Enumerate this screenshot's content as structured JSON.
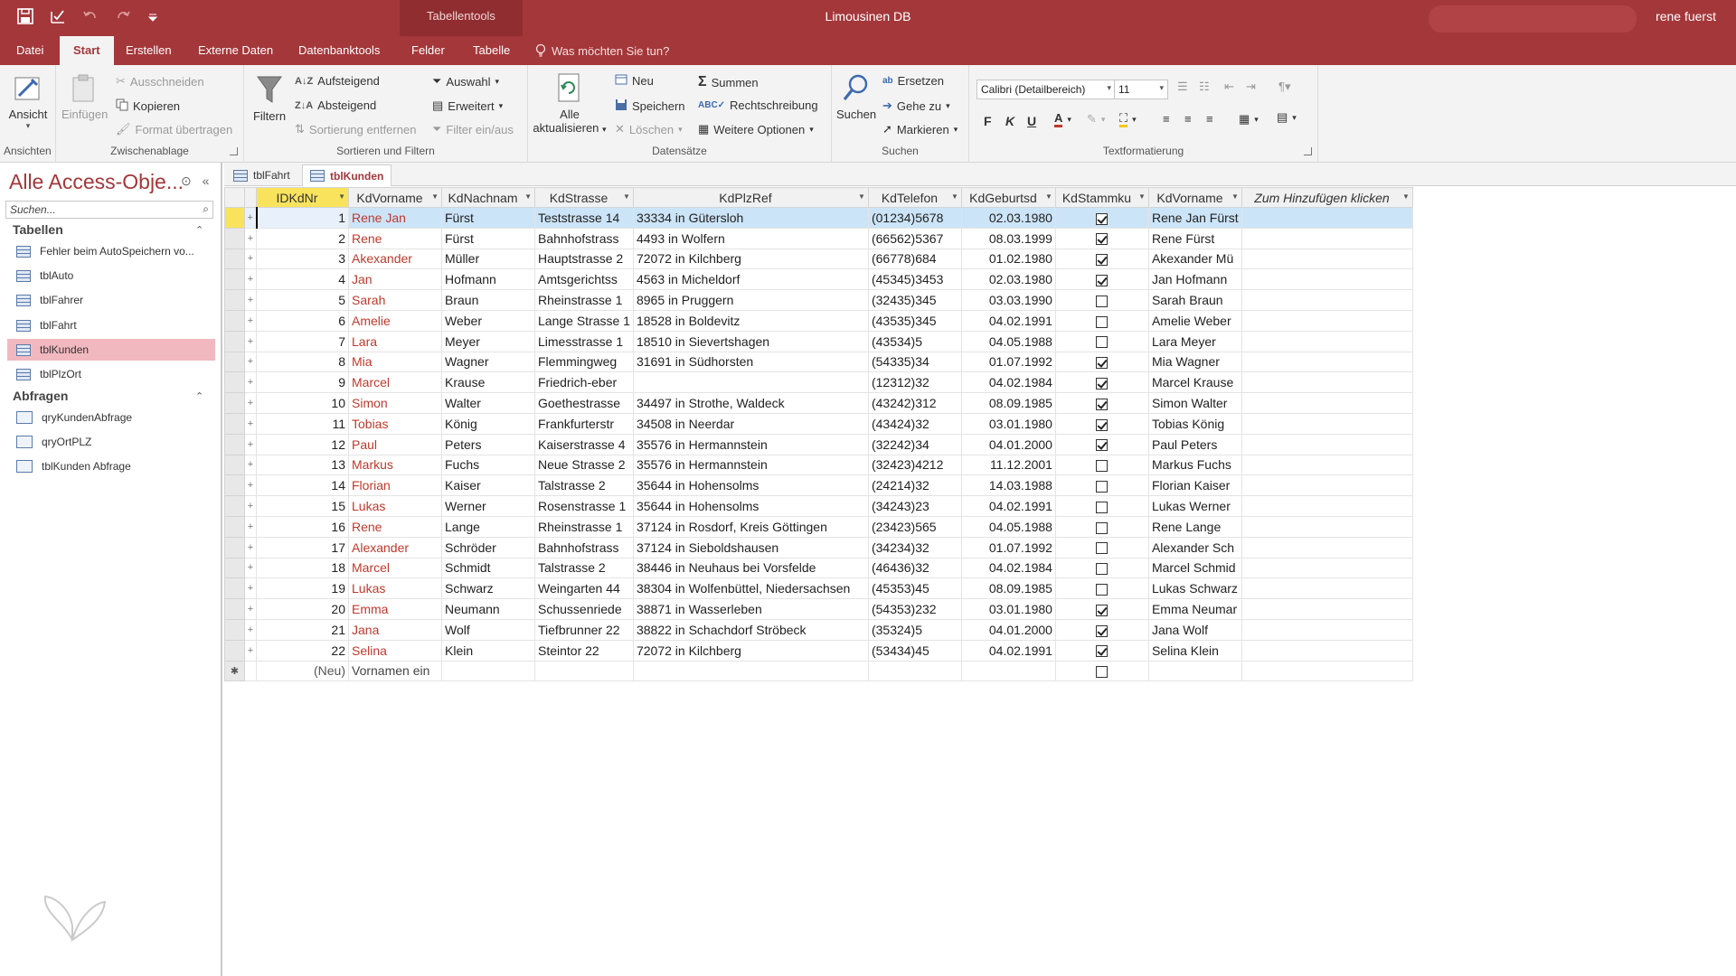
{
  "window": {
    "title": "Limousinen DB",
    "context_group": "Tabellentools",
    "user": "rene fuerst"
  },
  "tabs": [
    "Datei",
    "Start",
    "Erstellen",
    "Externe Daten",
    "Datenbanktools",
    "Felder",
    "Tabelle"
  ],
  "active_tab": "Start",
  "tell_me": "Was möchten Sie tun?",
  "ribbon": {
    "ansichten": {
      "label": "Ansichten",
      "ansicht": "Ansicht"
    },
    "zwischenablage": {
      "label": "Zwischenablage",
      "einfuegen": "Einfügen",
      "ausschneiden": "Ausschneiden",
      "kopieren": "Kopieren",
      "format": "Format übertragen"
    },
    "sortieren": {
      "label": "Sortieren und Filtern",
      "filtern": "Filtern",
      "aufsteigend": "Aufsteigend",
      "absteigend": "Absteigend",
      "sortierung_entfernen": "Sortierung entfernen",
      "auswahl": "Auswahl",
      "erweitert": "Erweitert",
      "filter_ein_aus": "Filter ein/aus"
    },
    "datensaetze": {
      "label": "Datensätze",
      "alle": "Alle",
      "aktualisieren": "aktualisieren",
      "neu": "Neu",
      "speichern": "Speichern",
      "loeschen": "Löschen",
      "summen": "Summen",
      "rechtschreibung": "Rechtschreibung",
      "weitere": "Weitere Optionen"
    },
    "suchen": {
      "label": "Suchen",
      "suchen": "Suchen",
      "ersetzen": "Ersetzen",
      "gehe_zu": "Gehe zu",
      "markieren": "Markieren"
    },
    "text": {
      "label": "Textformatierung",
      "font": "Calibri (Detailbereich)",
      "size": "11",
      "bold": "F",
      "italic": "K",
      "underline": "U"
    }
  },
  "nav": {
    "title": "Alle Access-Obje...",
    "search_placeholder": "Suchen...",
    "sections": [
      {
        "label": "Tabellen",
        "items": [
          "Fehler beim AutoSpeichern vo...",
          "tblAuto",
          "tblFahrer",
          "tblFahrt",
          "tblKunden",
          "tblPlzOrt"
        ]
      },
      {
        "label": "Abfragen",
        "items": [
          "qryKundenAbfrage",
          "qryOrtPLZ",
          "tblKunden Abfrage"
        ]
      }
    ],
    "selected": "tblKunden"
  },
  "doc_tabs": [
    "tblFahrt",
    "tblKunden"
  ],
  "active_doc_tab": "tblKunden",
  "grid": {
    "columns": [
      "IDKdNr",
      "KdVorname",
      "KdNachnam",
      "KdStrasse",
      "KdPlzRef",
      "KdTelefon",
      "KdGeburtsd",
      "KdStammku",
      "KdVorname",
      "Zum Hinzufügen klicken"
    ],
    "rows": [
      [
        "1",
        "Rene Jan",
        "Fürst",
        "Teststrasse 14",
        "33334 in Gütersloh",
        "(01234)5678",
        "02.03.1980",
        true,
        "Rene Jan Fürst"
      ],
      [
        "2",
        "Rene",
        "Fürst",
        "Bahnhofstrass",
        "4493 in Wolfern",
        "(66562)5367",
        "08.03.1999",
        true,
        "Rene Fürst"
      ],
      [
        "3",
        "Akexander",
        "Müller",
        "Hauptstrasse 2",
        "72072 in Kilchberg",
        "(66778)684",
        "01.02.1980",
        true,
        "Akexander Mü"
      ],
      [
        "4",
        "Jan",
        "Hofmann",
        "Amtsgerichtss",
        "4563 in Micheldorf",
        "(45345)3453",
        "02.03.1980",
        true,
        "Jan Hofmann"
      ],
      [
        "5",
        "Sarah",
        "Braun",
        "Rheinstrasse 1",
        "8965 in Pruggern",
        "(32435)345",
        "03.03.1990",
        false,
        "Sarah Braun"
      ],
      [
        "6",
        "Amelie",
        "Weber",
        "Lange Strasse 1",
        "18528 in Boldevitz",
        "(43535)345",
        "04.02.1991",
        false,
        "Amelie Weber"
      ],
      [
        "7",
        "Lara",
        "Meyer",
        "Limesstrasse 1",
        "18510 in Sievertshagen",
        "(43534)5",
        "04.05.1988",
        false,
        "Lara Meyer"
      ],
      [
        "8",
        "Mia",
        "Wagner",
        "Flemmingweg",
        "31691 in Südhorsten",
        "(54335)34",
        "01.07.1992",
        true,
        "Mia Wagner"
      ],
      [
        "9",
        "Marcel",
        "Krause",
        "Friedrich-eber",
        "",
        "(12312)32",
        "04.02.1984",
        true,
        "Marcel Krause"
      ],
      [
        "10",
        "Simon",
        "Walter",
        "Goethestrasse",
        "34497 in Strothe, Waldeck",
        "(43242)312",
        "08.09.1985",
        true,
        "Simon Walter"
      ],
      [
        "11",
        "Tobias",
        "König",
        "Frankfurterstr",
        "34508 in Neerdar",
        "(43424)32",
        "03.01.1980",
        true,
        "Tobias König"
      ],
      [
        "12",
        "Paul",
        "Peters",
        "Kaiserstrasse 4",
        "35576 in Hermannstein",
        "(32242)34",
        "04.01.2000",
        true,
        "Paul Peters"
      ],
      [
        "13",
        "Markus",
        "Fuchs",
        "Neue Strasse 2",
        "35576 in Hermannstein",
        "(32423)4212",
        "11.12.2001",
        false,
        "Markus Fuchs"
      ],
      [
        "14",
        "Florian",
        "Kaiser",
        "Talstrasse 2",
        "35644 in Hohensolms",
        "(24214)32",
        "14.03.1988",
        false,
        "Florian Kaiser"
      ],
      [
        "15",
        "Lukas",
        "Werner",
        "Rosenstrasse 1",
        "35644 in Hohensolms",
        "(34243)23",
        "04.02.1991",
        false,
        "Lukas Werner"
      ],
      [
        "16",
        "Rene",
        "Lange",
        "Rheinstrasse 1",
        "37124 in Rosdorf, Kreis Göttingen",
        "(23423)565",
        "04.05.1988",
        false,
        "Rene Lange"
      ],
      [
        "17",
        "Alexander",
        "Schröder",
        "Bahnhofstrass",
        "37124 in Sieboldshausen",
        "(34234)32",
        "01.07.1992",
        false,
        "Alexander Sch"
      ],
      [
        "18",
        "Marcel",
        "Schmidt",
        "Talstrasse 2",
        "38446 in Neuhaus bei Vorsfelde",
        "(46436)32",
        "04.02.1984",
        false,
        "Marcel Schmid"
      ],
      [
        "19",
        "Lukas",
        "Schwarz",
        "Weingarten 44",
        "38304 in Wolfenbüttel, Niedersachsen",
        "(45353)45",
        "08.09.1985",
        false,
        "Lukas Schwarz"
      ],
      [
        "20",
        "Emma",
        "Neumann",
        "Schussenriede",
        "38871 in Wasserleben",
        "(54353)232",
        "03.01.1980",
        true,
        "Emma Neumar"
      ],
      [
        "21",
        "Jana",
        "Wolf",
        "Tiefbrunner 22",
        "38822 in Schachdorf Ströbeck",
        "(35324)5",
        "04.01.2000",
        true,
        "Jana Wolf"
      ],
      [
        "22",
        "Selina",
        "Klein",
        "Steintor 22",
        "72072 in Kilchberg",
        "(53434)45",
        "04.02.1991",
        true,
        "Selina Klein"
      ]
    ],
    "new_row": {
      "id": "(Neu)",
      "vorname": "Vornamen ein"
    }
  }
}
